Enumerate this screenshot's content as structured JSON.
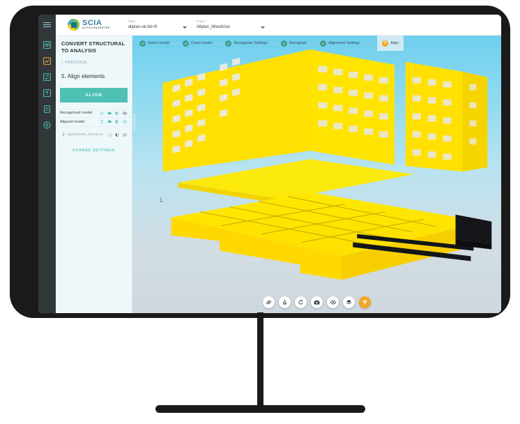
{
  "app": {
    "brand_title": "SCIA",
    "brand_subtitle": "AUTOCONVERTER",
    "logo_icon": "scia-circle-logo"
  },
  "topbar": {
    "menu_icon": "hamburger-menu-icon",
    "team": {
      "label": "Team",
      "value": "allplan-uk-ltd-rft",
      "caret_icon": "chevron-down-icon"
    },
    "project": {
      "label": "Project",
      "value": "Allplan_MixedUse",
      "caret_icon": "chevron-down-icon"
    }
  },
  "icon_rail": {
    "items": [
      {
        "name": "structural-model-icon",
        "color": "#4fc0b4"
      },
      {
        "name": "analysis-model-icon",
        "color": "#e8a33d"
      },
      {
        "name": "convert-icon",
        "color": "#4fc0b4"
      },
      {
        "name": "export-icon",
        "color": "#4fc0b4"
      },
      {
        "name": "reports-icon",
        "color": "#4fc0b4"
      },
      {
        "name": "settings-gear-icon",
        "color": "#4fc0b4"
      }
    ]
  },
  "sidebar": {
    "panel_title": "CONVERT STRUCTURAL TO ANALYSIS",
    "previous_label": "PREVIOUS",
    "previous_icon": "chevron-left-icon",
    "step_title": "5.  Align elements",
    "align_button": "ALIGN",
    "model_rows": [
      {
        "label": "Recognized model",
        "icons": [
          "delete-icon",
          "cloud-download-icon",
          "contrast-icon",
          "eye-icon"
        ]
      },
      {
        "label": "Aligned model",
        "icons": [
          "delete-icon",
          "cloud-download-icon",
          "contrast-icon",
          "eye-icon"
        ]
      }
    ],
    "tree_item": {
      "caret_icon": "chevron-right-icon",
      "label": "AllplanModel_MixedUse",
      "icons": [
        "history-icon",
        "contrast-icon",
        "eye-off-icon"
      ]
    },
    "change_settings": "CHANGE SETTINGS"
  },
  "stepper": {
    "steps": [
      {
        "label": "Select model",
        "state": "done",
        "badge": "check-icon"
      },
      {
        "label": "Clean model",
        "state": "done",
        "badge": "check-icon"
      },
      {
        "label": "Recognizer Settings",
        "state": "done",
        "badge": "check-icon"
      },
      {
        "label": "Recognize",
        "state": "done",
        "badge": "check-icon"
      },
      {
        "label": "Alignment Settings",
        "state": "done",
        "badge": "check-icon"
      },
      {
        "label": "Align",
        "state": "active",
        "badge": "6"
      }
    ]
  },
  "viewport": {
    "orientation_marker": "L",
    "model_color": "#ffe000",
    "model_dark_color": "#14161a",
    "toolbar": [
      {
        "name": "orbit-rotate-icon",
        "accent": false
      },
      {
        "name": "measure-icon",
        "accent": false
      },
      {
        "name": "reset-view-icon",
        "accent": false
      },
      {
        "name": "screenshot-camera-icon",
        "accent": false
      },
      {
        "name": "visibility-eye-icon",
        "accent": false
      },
      {
        "name": "layers-icon",
        "accent": false
      },
      {
        "name": "filter-icon",
        "accent": true
      }
    ]
  },
  "colors": {
    "accent_teal": "#4fc0b4",
    "accent_orange": "#f5a623",
    "sidebar_bg": "#eef8fa",
    "rail_bg": "#32373a",
    "bezel": "#1a1a1a",
    "sky_top": "#6ecfee",
    "sky_bottom": "#ced7de"
  }
}
